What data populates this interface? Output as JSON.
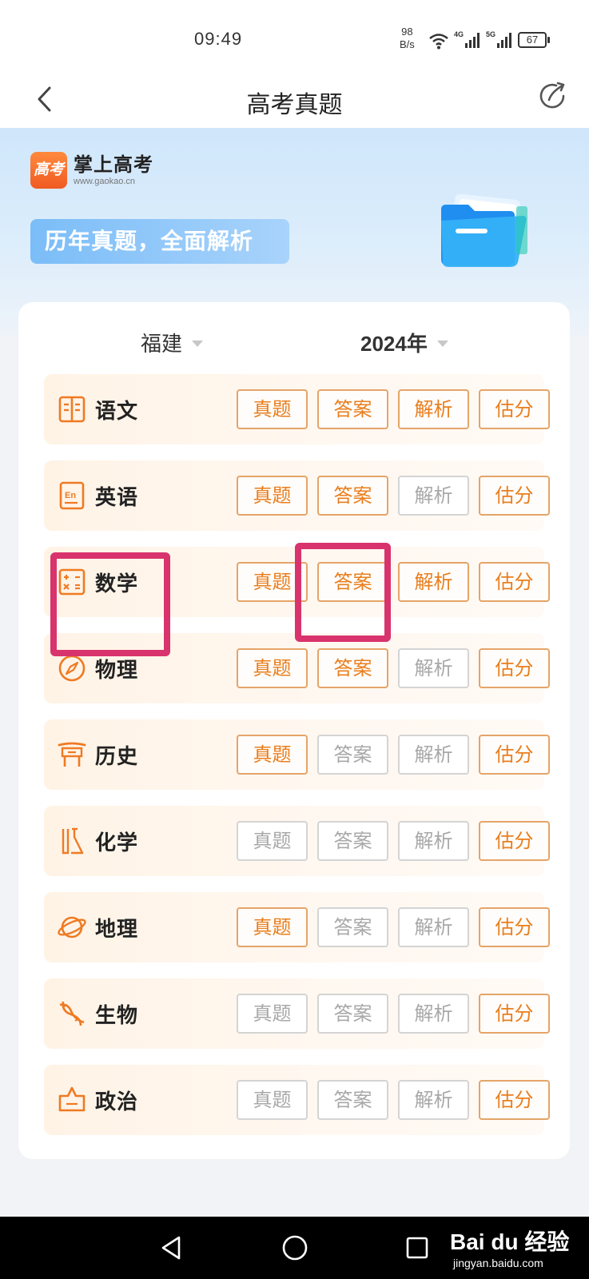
{
  "status_bar": {
    "time": "09:49",
    "speed_value": "98",
    "speed_unit": "B/s",
    "signal_1": "4G",
    "signal_2": "5G",
    "battery": "67"
  },
  "header": {
    "title": "高考真题"
  },
  "banner": {
    "logo_mark": "高考",
    "logo_name": "掌上高考",
    "logo_url": "www.gaokao.cn",
    "slogan": "历年真题，全面解析"
  },
  "filters": {
    "province": "福建",
    "year": "2024年"
  },
  "subjects": [
    {
      "name": "语文",
      "icon": "book-icon",
      "buttons": [
        {
          "label": "真题",
          "enabled": true
        },
        {
          "label": "答案",
          "enabled": true
        },
        {
          "label": "解析",
          "enabled": true
        },
        {
          "label": "估分",
          "enabled": true
        }
      ]
    },
    {
      "name": "英语",
      "icon": "english-icon",
      "buttons": [
        {
          "label": "真题",
          "enabled": true
        },
        {
          "label": "答案",
          "enabled": true
        },
        {
          "label": "解析",
          "enabled": false
        },
        {
          "label": "估分",
          "enabled": true
        }
      ]
    },
    {
      "name": "数学",
      "icon": "calculator-icon",
      "buttons": [
        {
          "label": "真题",
          "enabled": true
        },
        {
          "label": "答案",
          "enabled": true
        },
        {
          "label": "解析",
          "enabled": true
        },
        {
          "label": "估分",
          "enabled": true
        }
      ]
    },
    {
      "name": "物理",
      "icon": "compass-icon",
      "buttons": [
        {
          "label": "真题",
          "enabled": true
        },
        {
          "label": "答案",
          "enabled": true
        },
        {
          "label": "解析",
          "enabled": false
        },
        {
          "label": "估分",
          "enabled": true
        }
      ]
    },
    {
      "name": "历史",
      "icon": "gate-icon",
      "buttons": [
        {
          "label": "真题",
          "enabled": true
        },
        {
          "label": "答案",
          "enabled": false
        },
        {
          "label": "解析",
          "enabled": false
        },
        {
          "label": "估分",
          "enabled": true
        }
      ]
    },
    {
      "name": "化学",
      "icon": "flask-icon",
      "buttons": [
        {
          "label": "真题",
          "enabled": false
        },
        {
          "label": "答案",
          "enabled": false
        },
        {
          "label": "解析",
          "enabled": false
        },
        {
          "label": "估分",
          "enabled": true
        }
      ]
    },
    {
      "name": "地理",
      "icon": "planet-icon",
      "buttons": [
        {
          "label": "真题",
          "enabled": true
        },
        {
          "label": "答案",
          "enabled": false
        },
        {
          "label": "解析",
          "enabled": false
        },
        {
          "label": "估分",
          "enabled": true
        }
      ]
    },
    {
      "name": "生物",
      "icon": "dna-icon",
      "buttons": [
        {
          "label": "真题",
          "enabled": false
        },
        {
          "label": "答案",
          "enabled": false
        },
        {
          "label": "解析",
          "enabled": false
        },
        {
          "label": "估分",
          "enabled": true
        }
      ]
    },
    {
      "name": "政治",
      "icon": "pentagon-icon",
      "buttons": [
        {
          "label": "真题",
          "enabled": false
        },
        {
          "label": "答案",
          "enabled": false
        },
        {
          "label": "解析",
          "enabled": false
        },
        {
          "label": "估分",
          "enabled": true
        }
      ]
    }
  ],
  "watermark": {
    "main": "Bai du 经验",
    "sub": "jingyan.baidu.com"
  },
  "colors": {
    "accent": "#e97e1d",
    "accent_border": "#e5a468",
    "disabled": "#a8a8a8",
    "highlight": "#d8336c"
  }
}
